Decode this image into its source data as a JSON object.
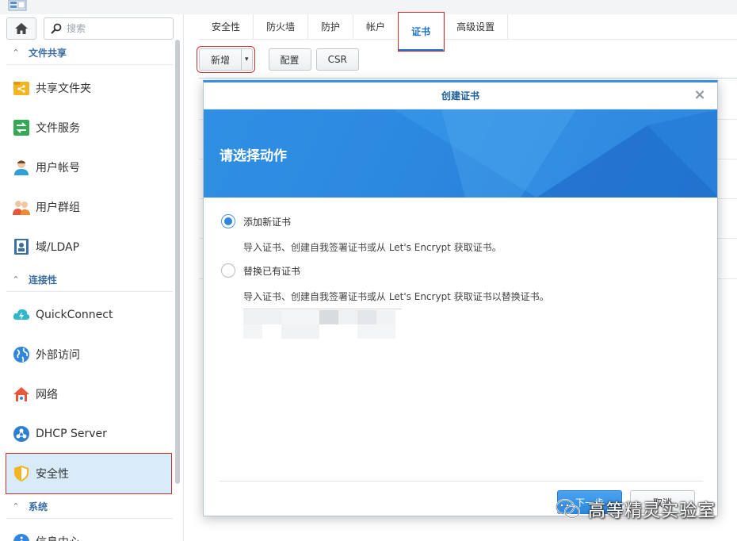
{
  "sidebar": {
    "search_placeholder": "搜索",
    "sections": [
      {
        "label": "文件共享",
        "items": [
          {
            "label": "共享文件夹",
            "icon": "shared-folder-icon"
          },
          {
            "label": "文件服务",
            "icon": "file-services-icon"
          },
          {
            "label": "用户帐号",
            "icon": "user-icon"
          },
          {
            "label": "用户群组",
            "icon": "group-icon"
          },
          {
            "label": "域/LDAP",
            "icon": "ldap-icon"
          }
        ]
      },
      {
        "label": "连接性",
        "items": [
          {
            "label": "QuickConnect",
            "icon": "quickconnect-icon"
          },
          {
            "label": "外部访问",
            "icon": "external-access-icon"
          },
          {
            "label": "网络",
            "icon": "network-icon"
          },
          {
            "label": "DHCP Server",
            "icon": "dhcp-icon"
          },
          {
            "label": "安全性",
            "icon": "security-shield-icon",
            "active": true
          }
        ]
      },
      {
        "label": "系统",
        "items": [
          {
            "label": "信息中心",
            "icon": "info-center-icon"
          }
        ]
      }
    ]
  },
  "tabs": [
    "安全性",
    "防火墙",
    "防护",
    "帐户",
    "证书",
    "高级设置"
  ],
  "active_tab": "证书",
  "toolbar": {
    "add_label": "新增",
    "config_label": "配置",
    "csr_label": "CSR"
  },
  "dialog": {
    "title": "创建证书",
    "banner_title": "请选择动作",
    "options": [
      {
        "label": "添加新证书",
        "description": "导入证书、创建自我签署证书或从 Let's Encrypt 获取证书。",
        "selected": true
      },
      {
        "label": "替换已有证书",
        "description": "导入证书、创建自我签署证书或从 Let's Encrypt 获取证书以替换证书。",
        "selected": false
      }
    ],
    "next_label": "下一步",
    "cancel_label": "取消"
  },
  "watermark": "高等精灵实验室",
  "colors": {
    "accent": "#2f86dc",
    "section_label": "#3b6ea5",
    "highlight_box": "#d12b2b",
    "active_item_bg": "#d9ebf9"
  }
}
